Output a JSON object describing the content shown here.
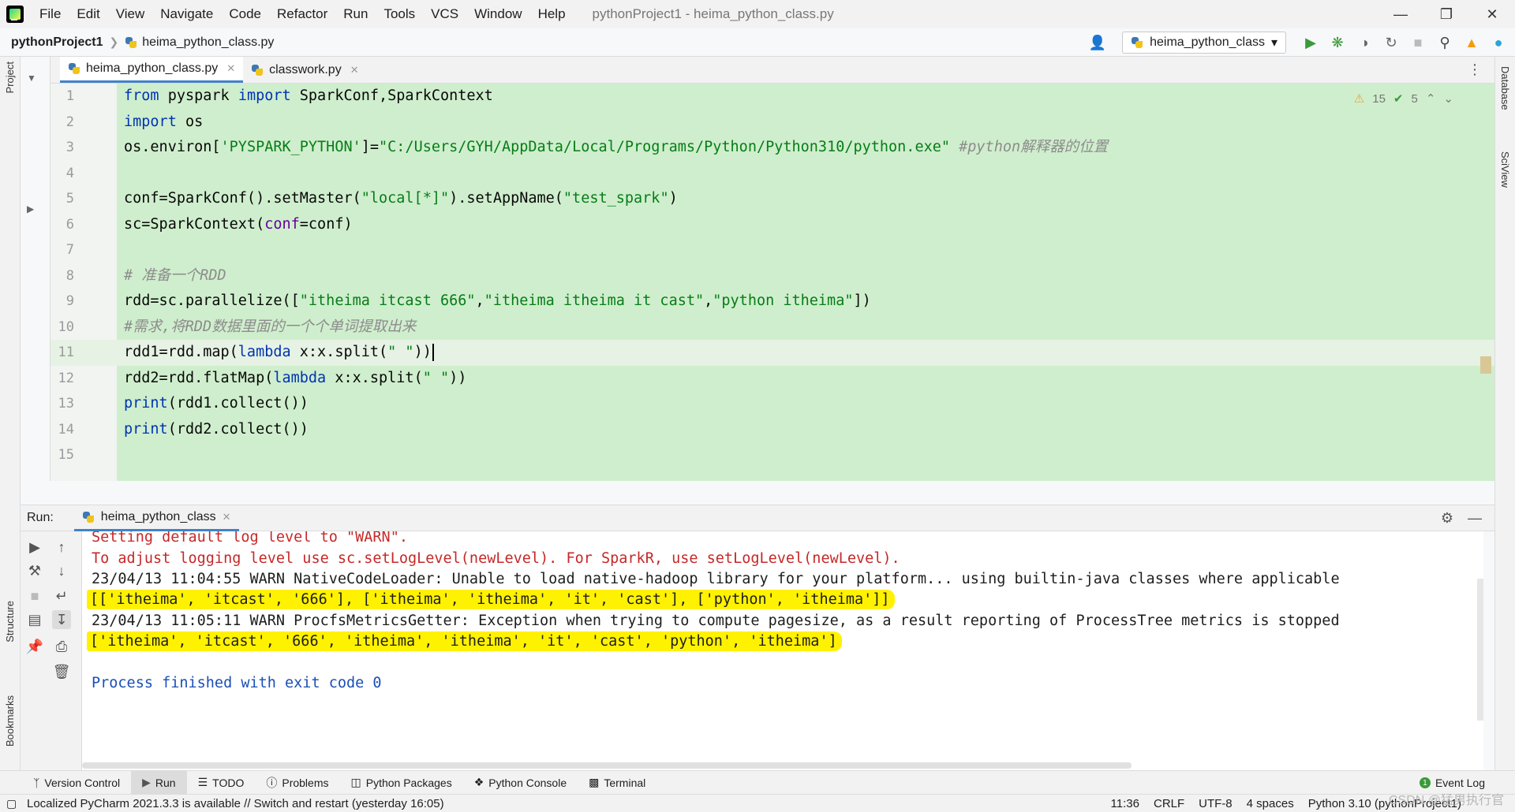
{
  "window": {
    "title": "pythonProject1 - heima_python_class.py",
    "menu": [
      "File",
      "Edit",
      "View",
      "Navigate",
      "Code",
      "Refactor",
      "Run",
      "Tools",
      "VCS",
      "Window",
      "Help"
    ]
  },
  "navbar": {
    "project": "pythonProject1",
    "file": "heima_python_class.py",
    "run_config": "heima_python_class"
  },
  "editor": {
    "tabs": [
      {
        "label": "heima_python_class.py",
        "active": true
      },
      {
        "label": "classwork.py",
        "active": false
      }
    ],
    "inspections": {
      "warnings": "15",
      "weak_warnings": "5"
    },
    "line_numbers": [
      "1",
      "2",
      "3",
      "4",
      "5",
      "6",
      "7",
      "8",
      "9",
      "10",
      "11",
      "12",
      "13",
      "14",
      "15"
    ],
    "current_line": 11
  },
  "run_panel": {
    "label": "Run:",
    "tab": "heima_python_class",
    "console": {
      "line1": "Setting default log level to \"WARN\".",
      "line2": "To adjust logging level use sc.setLogLevel(newLevel). For SparkR, use setLogLevel(newLevel).",
      "line3": "23/04/13 11:04:55 WARN NativeCodeLoader: Unable to load native-hadoop library for your platform... using builtin-java classes where applicable",
      "line4": "[['itheima', 'itcast', '666'], ['itheima', 'itheima', 'it', 'cast'], ['python', 'itheima']]",
      "line5": "23/04/13 11:05:11 WARN ProcfsMetricsGetter: Exception when trying to compute pagesize, as a result reporting of ProcessTree metrics is stopped",
      "line6": "['itheima', 'itcast', '666', 'itheima', 'itheima', 'it', 'cast', 'python', 'itheima']",
      "line7": "Process finished with exit code 0"
    }
  },
  "side_strips": {
    "left": [
      "Project",
      "Structure",
      "Bookmarks"
    ],
    "right": [
      "Database",
      "SciView"
    ]
  },
  "bottom_tools": [
    "Version Control",
    "Run",
    "TODO",
    "Problems",
    "Python Packages",
    "Python Console",
    "Terminal"
  ],
  "event_log": "Event Log",
  "status": {
    "message": "Localized PyCharm 2021.3.3 is available // Switch and restart (yesterday 16:05)",
    "position": "11:36",
    "line_sep": "CRLF",
    "encoding": "UTF-8",
    "indent": "4 spaces",
    "interpreter": "Python 3.10 (pythonProject1)"
  },
  "watermark": "CSDN @猛男执行官",
  "colors": {
    "editor_bg": "#cfeecd",
    "keyword": "#0033b3",
    "string": "#067d17",
    "comment": "#8c8c8c",
    "console_error": "#c62828",
    "highlight": "#fff200",
    "accent": "#4083c9"
  }
}
